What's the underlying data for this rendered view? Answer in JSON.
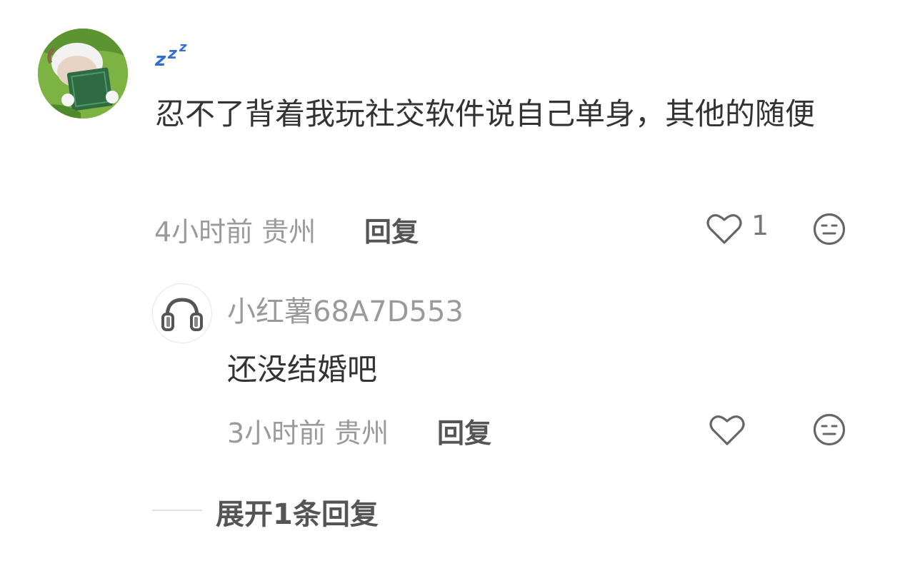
{
  "main_comment": {
    "username_icon": "zzz-sleep-icon",
    "text": "忍不了背着我玩社交软件说自己单身，其他的随便",
    "time_location": "4小时前 贵州",
    "reply_label": "回复",
    "like_count": "1",
    "like_icon": "heart-outline-icon",
    "dislike_icon": "meh-face-icon"
  },
  "reply": {
    "username": "小红薯68A7D553",
    "text": "还没结婚吧",
    "time_location": "3小时前 贵州",
    "reply_label": "回复",
    "like_icon": "heart-outline-icon",
    "dislike_icon": "meh-face-icon"
  },
  "expand": {
    "label": "展开1条回复"
  },
  "colors": {
    "primary_text": "#333333",
    "secondary_text": "#9a9a9a",
    "icon": "#666666",
    "zzz_blue": "#2f6fd6"
  }
}
